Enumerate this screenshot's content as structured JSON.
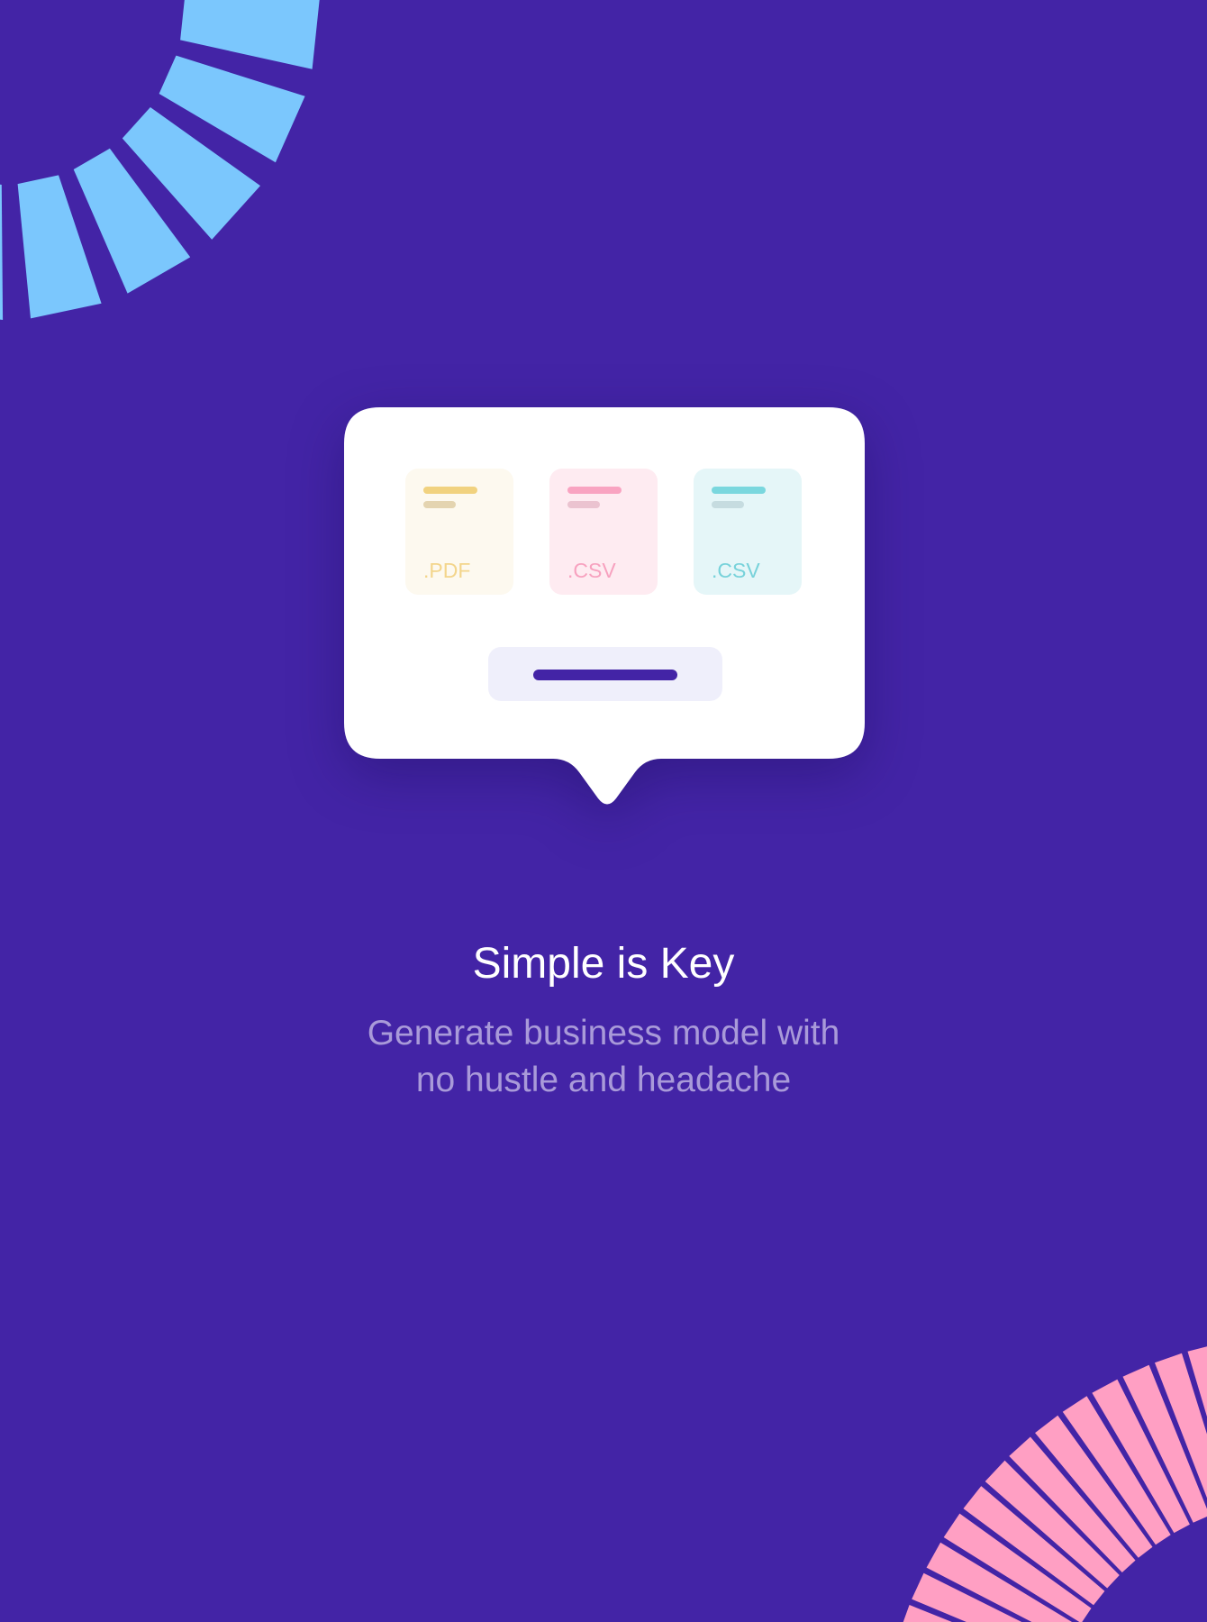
{
  "theme": {
    "background": "#4324A6",
    "blue_accent": "#7BC7FD",
    "pink_accent": "#FF9FC3",
    "card_background": "#FFFFFF"
  },
  "files": [
    {
      "extension": ".PDF",
      "color": "#F3D58B"
    },
    {
      "extension": ".CSV",
      "color": "#F7A1BF"
    },
    {
      "extension": ".CSV",
      "color": "#77D2DA"
    }
  ],
  "onboarding": {
    "title": "Simple is Key",
    "subtitle_line1": "Generate business model with",
    "subtitle_line2": "no hustle and headache"
  }
}
